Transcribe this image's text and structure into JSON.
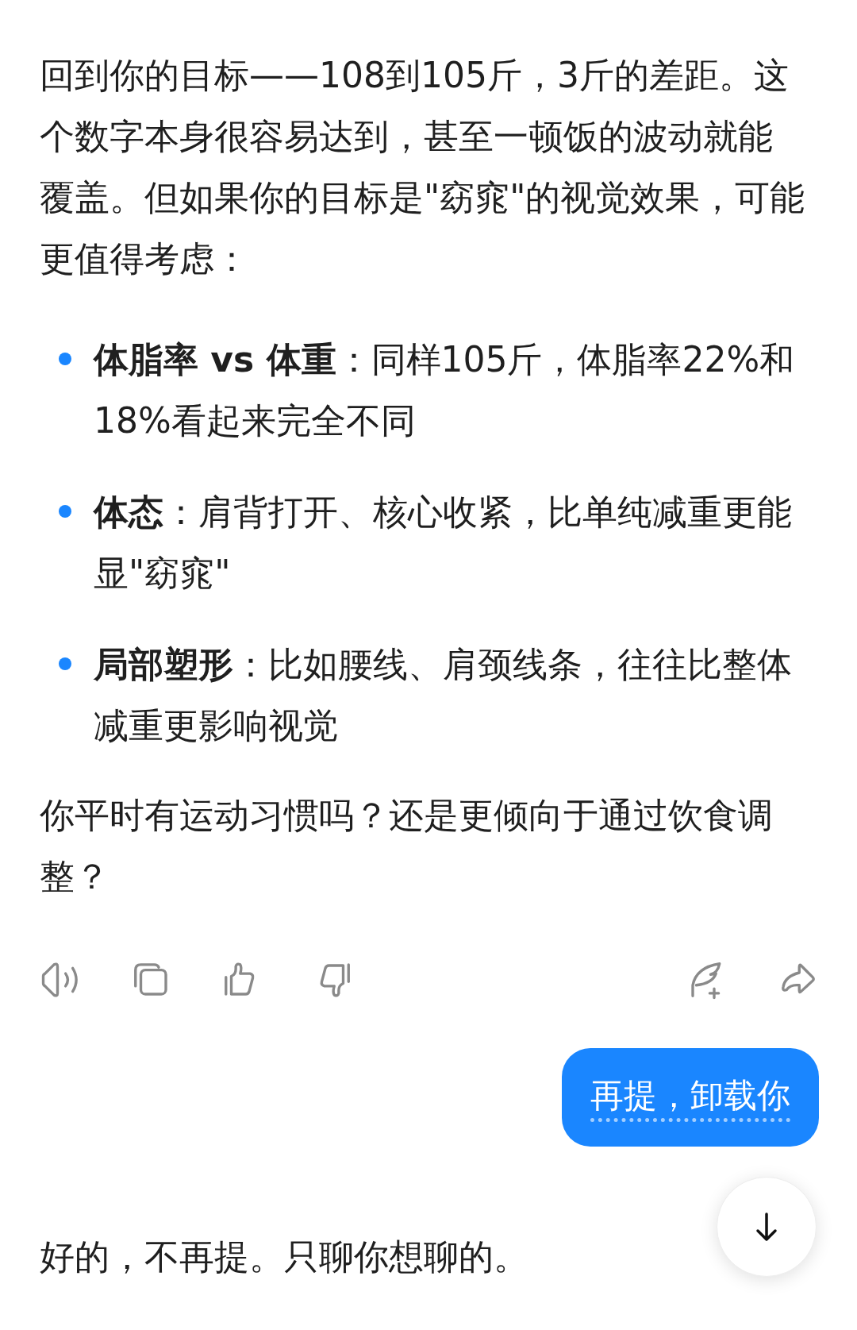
{
  "reply": {
    "paragraphs": [
      "回到你的目标——108到105斤，3斤的差距。这个数字本身很容易达到，甚至一顿饭的波动就能覆盖。但如果你的目标是\"窈窕\"的视觉效果，可能更值得考虑："
    ],
    "bullets": [
      "**体脂率 vs 体重**：同样105斤，体脂率22%和18%看起来完全不同",
      "**体态**：肩背打开、核心收紧，比单纯减重更能显\"窈窕\"",
      "**局部塑形**：比如腰线、肩颈线条，往往比整体减重更影响视觉"
    ],
    "closing": "你平时有运动习惯吗？还是更倾向于通过饮食调整？"
  },
  "actions": [
    {
      "kind": "speaker"
    },
    {
      "kind": "copy"
    },
    {
      "kind": "like"
    },
    {
      "kind": "dislike"
    },
    {
      "kind": "spacer"
    },
    {
      "kind": "quill"
    },
    {
      "kind": "share"
    }
  ],
  "user_message": "再提，卸载你",
  "last_reply": "好的，不再提。只聊你想聊的。",
  "scroll_button": {
    "kind": "down"
  }
}
